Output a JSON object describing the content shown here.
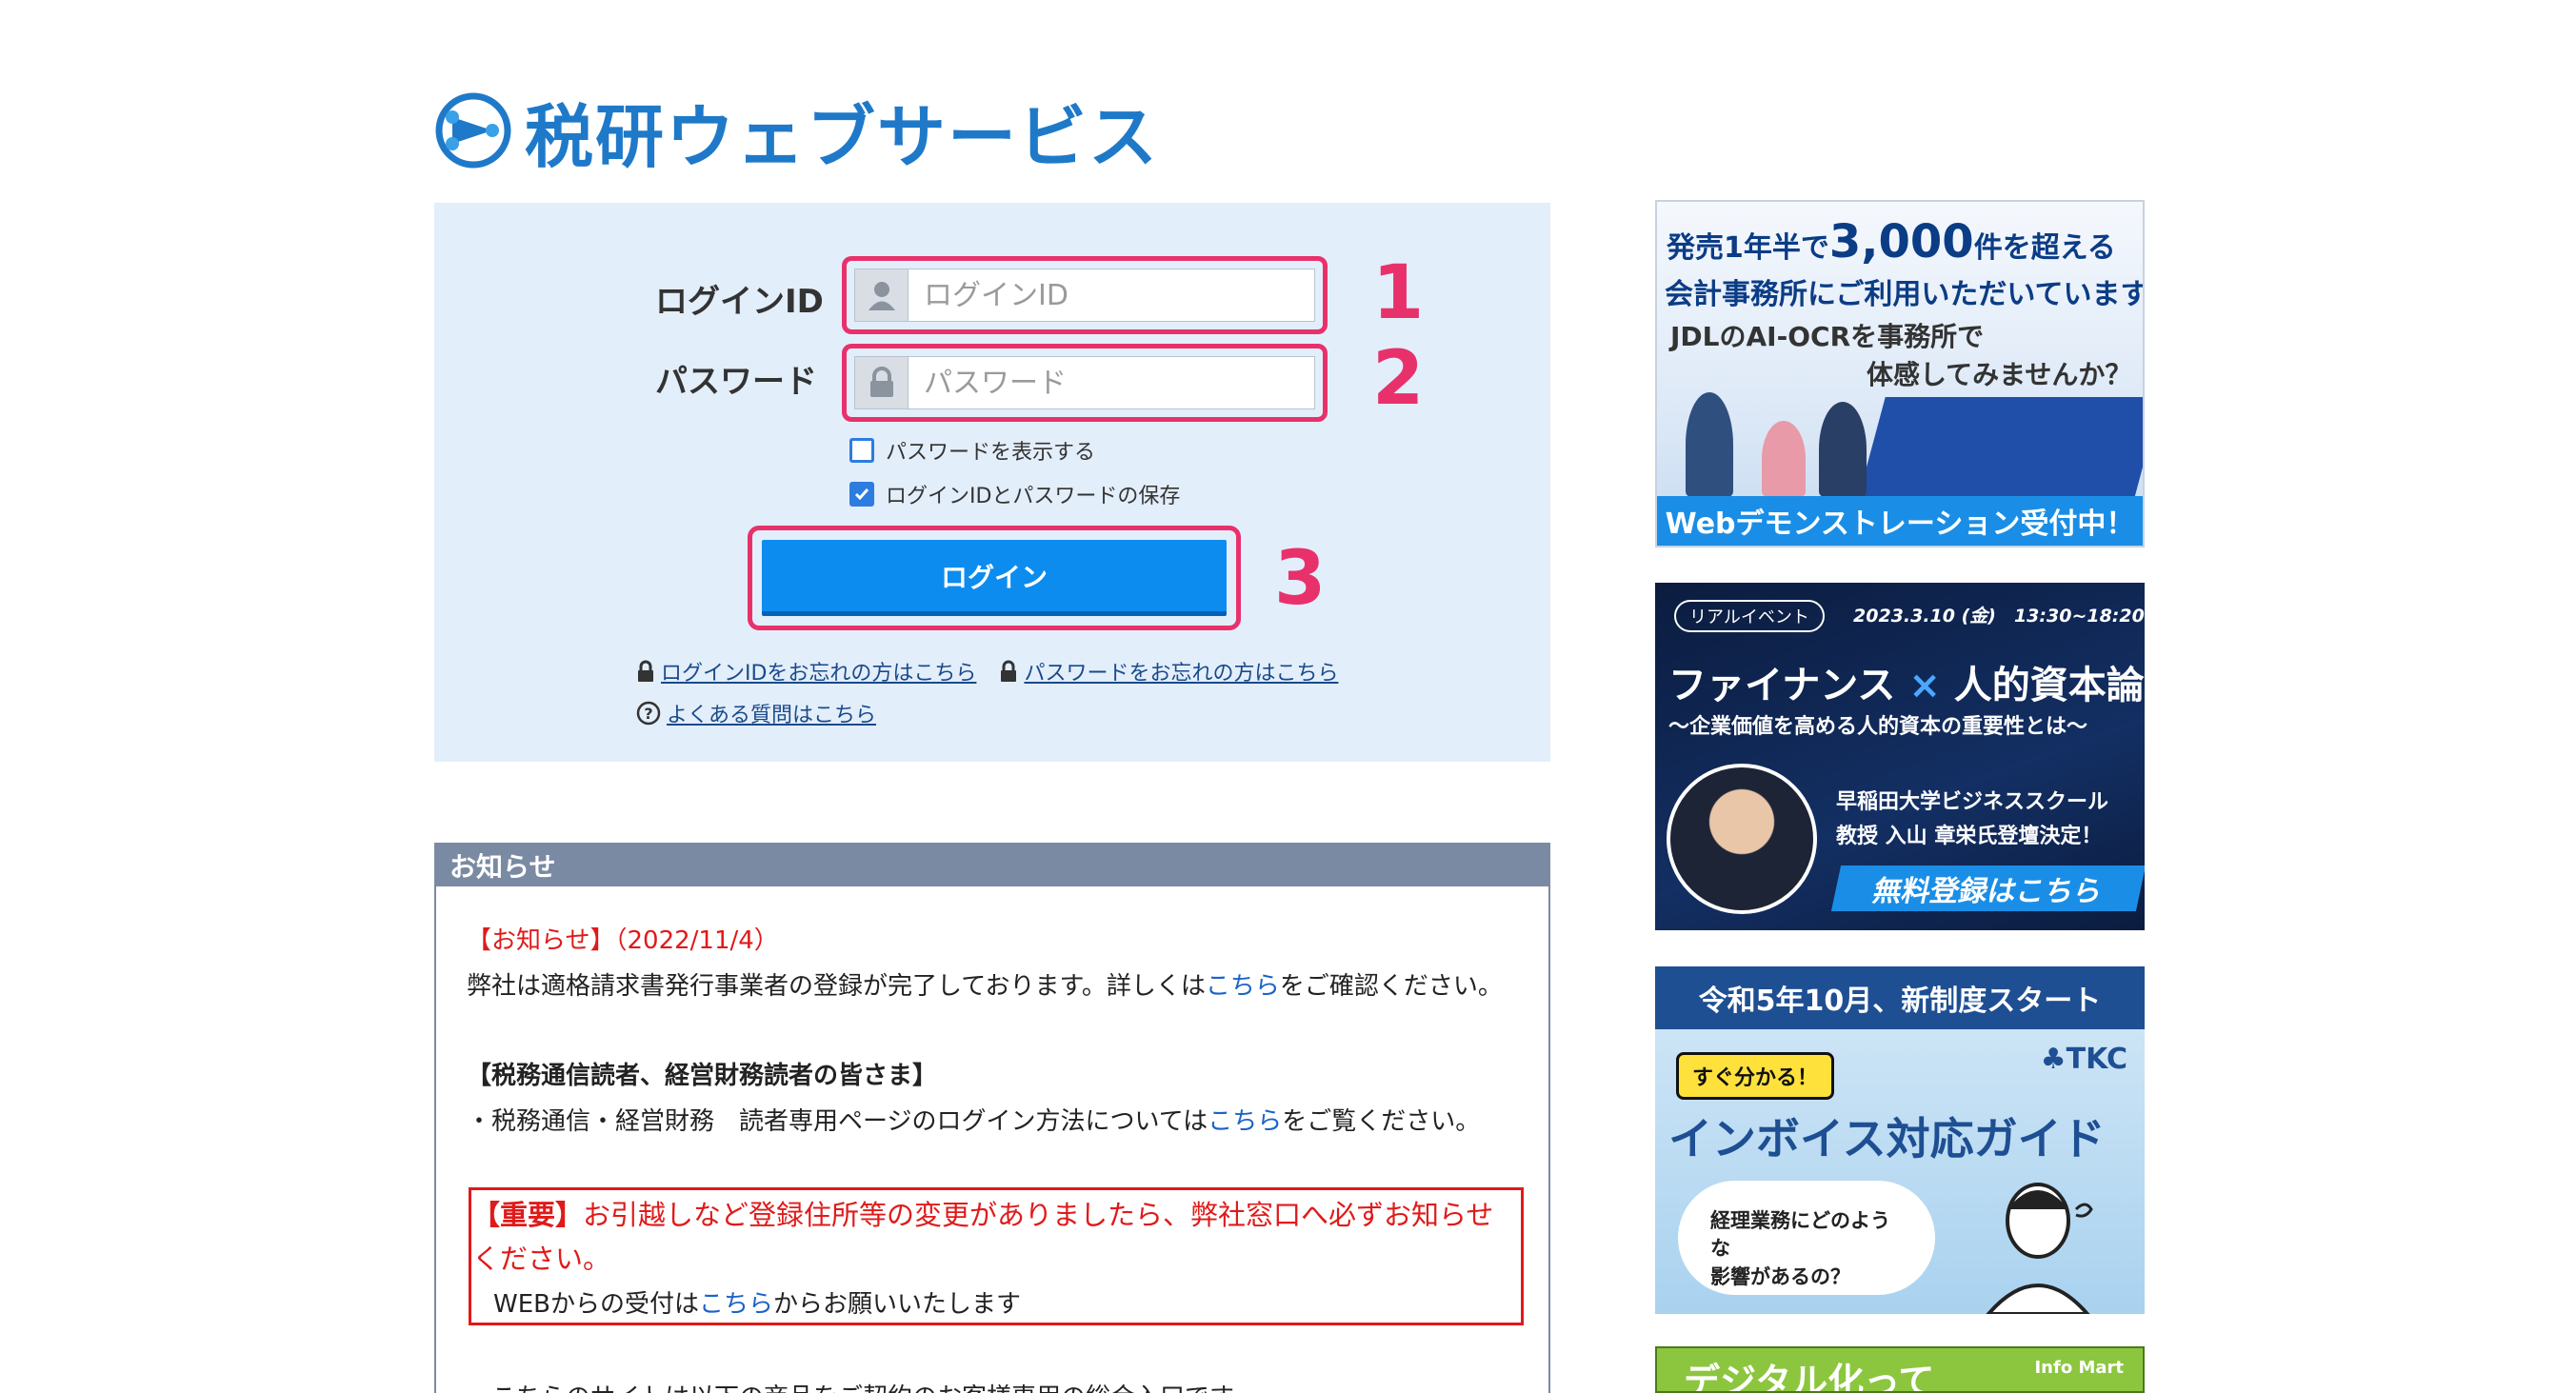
{
  "logo": {
    "text": "税研ウェブサービス"
  },
  "login": {
    "id_label": "ログインID",
    "id_placeholder": "ログインID",
    "password_label": "パスワード",
    "password_placeholder": "パスワード",
    "show_password_label": "パスワードを表示する",
    "show_password_checked": false,
    "remember_label": "ログインIDとパスワードの保存",
    "remember_checked": true,
    "submit_label": "ログイン",
    "forgot_id_link": "ログインIDをお忘れの方はこちら",
    "forgot_password_link": "パスワードをお忘れの方はこちら",
    "faq_link": "よくある質問はこちら"
  },
  "annotations": {
    "step1": "1",
    "step2": "2",
    "step3": "3",
    "highlight_color": "#e8316b"
  },
  "notice": {
    "heading": "お知らせ",
    "item1_title": "【お知らせ】（2022/11/4）",
    "item1_text_before": "弊社は適格請求書発行事業者の登録が完了しております。詳しくは",
    "item1_link": "こちら",
    "item1_text_after": "をご確認ください。",
    "item2_title": "【税務通信読者、経営財務読者の皆さま】",
    "item2_text_before": "・税務通信・経営財務　読者専用ページのログイン方法については",
    "item2_link": "こちら",
    "item2_text_after": "をご覧ください。",
    "important_label": "【重要】",
    "important_text_1": "お引越しなど登録住所等の変更がありましたら、弊社窓口へ必ずお知らせ",
    "important_text_2": "ください。",
    "important_web_before": "WEBからの受付は",
    "important_web_link": "こちら",
    "important_web_after": "からお願いいたします",
    "item4_text": "・こちらのサイトは以下の商品をご契約のお客様専用の総合入口です。"
  },
  "banners": {
    "b1": {
      "line1_pre": "発売1年半で",
      "line1_big": "3,000",
      "line1_post": "件を超える",
      "line2": "会計事務所にご利用いただいています。",
      "line3": "JDLのAI-OCRを事務所で",
      "line4": "体感してみませんか？",
      "footer": "Webデモンストレーション受付中！"
    },
    "b2": {
      "tag": "リアルイベント",
      "date": "2023.3.10 (金)　13:30~18:20",
      "title_a": "ファイナンス",
      "title_x": "×",
      "title_b": "人的資本論",
      "subtitle": "～企業価値を高める人的資本の重要性とは～",
      "speaker1": "早稲田大学ビジネススクール",
      "speaker2": "教授 入山 章栄氏登壇決定！",
      "cta": "無料登録はこちら"
    },
    "b3": {
      "header": "令和5年10月、新制度スタート",
      "brand": "TKC",
      "badge": "すぐ分かる！",
      "title": "インボイス対応ガイド",
      "bubble_1": "経理業務にどのような",
      "bubble_2": "影響があるの？"
    },
    "b4": {
      "text": "デジタル化って",
      "brand": "Info Mart"
    }
  }
}
